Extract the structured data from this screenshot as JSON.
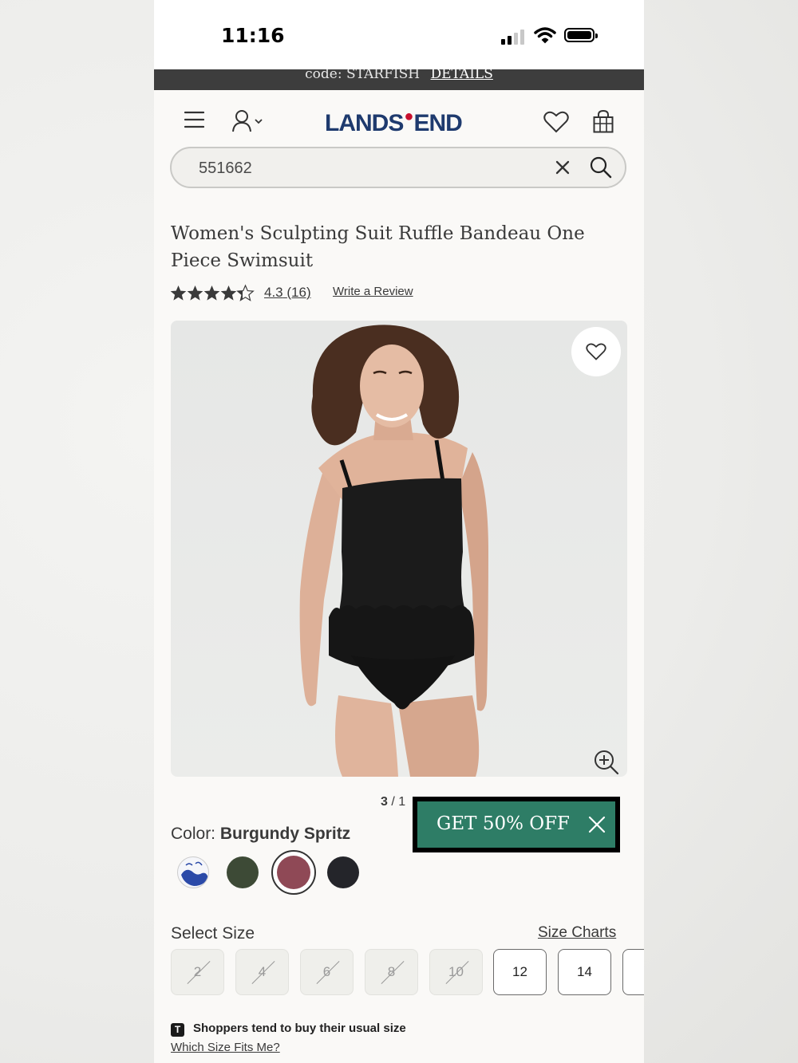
{
  "status_bar": {
    "time": "11:16"
  },
  "promo_banner": {
    "code_text": "code: STARFISH",
    "details_label": "DETAILS"
  },
  "header": {
    "brand": "LANDS END",
    "brand_left": "LANDS",
    "brand_right": "END",
    "menu_icon": "hamburger-icon",
    "account_icon": "account-icon",
    "wishlist_icon": "heart-icon",
    "bag_icon": "shopping-bag-icon"
  },
  "search": {
    "value": "551662",
    "clear_icon": "close-icon",
    "search_icon": "search-icon"
  },
  "product": {
    "title": "Women's Sculpting Suit Ruffle Bandeau One Piece Swimsuit",
    "rating": 4.3,
    "rating_text": "4.3",
    "review_count": "(16)",
    "write_review": "Write a Review",
    "image_alt": "Model wearing black ruffle bandeau one piece swimsuit",
    "image_counter_current": "3",
    "image_counter_sep": " / 1"
  },
  "offer": {
    "label": "GET 50% OFF"
  },
  "color": {
    "label": "Color: ",
    "selected": "Burgundy Spritz",
    "swatches": [
      {
        "name": "blue-white-print",
        "color": "#2b4aa8"
      },
      {
        "name": "green",
        "color": "#3d4a36"
      },
      {
        "name": "burgundy-spritz",
        "color": "#8f4956",
        "selected": true
      },
      {
        "name": "black",
        "color": "#24252a"
      }
    ]
  },
  "size": {
    "label": "Select Size",
    "chart_link": "Size Charts",
    "options": [
      {
        "label": "2",
        "available": false
      },
      {
        "label": "4",
        "available": false
      },
      {
        "label": "6",
        "available": false
      },
      {
        "label": "8",
        "available": false
      },
      {
        "label": "10",
        "available": false
      },
      {
        "label": "12",
        "available": true
      },
      {
        "label": "14",
        "available": true
      }
    ]
  },
  "fit_tip": {
    "icon_letter": "T",
    "text": "Shoppers tend to buy their usual size",
    "link": "Which Size Fits Me?"
  }
}
